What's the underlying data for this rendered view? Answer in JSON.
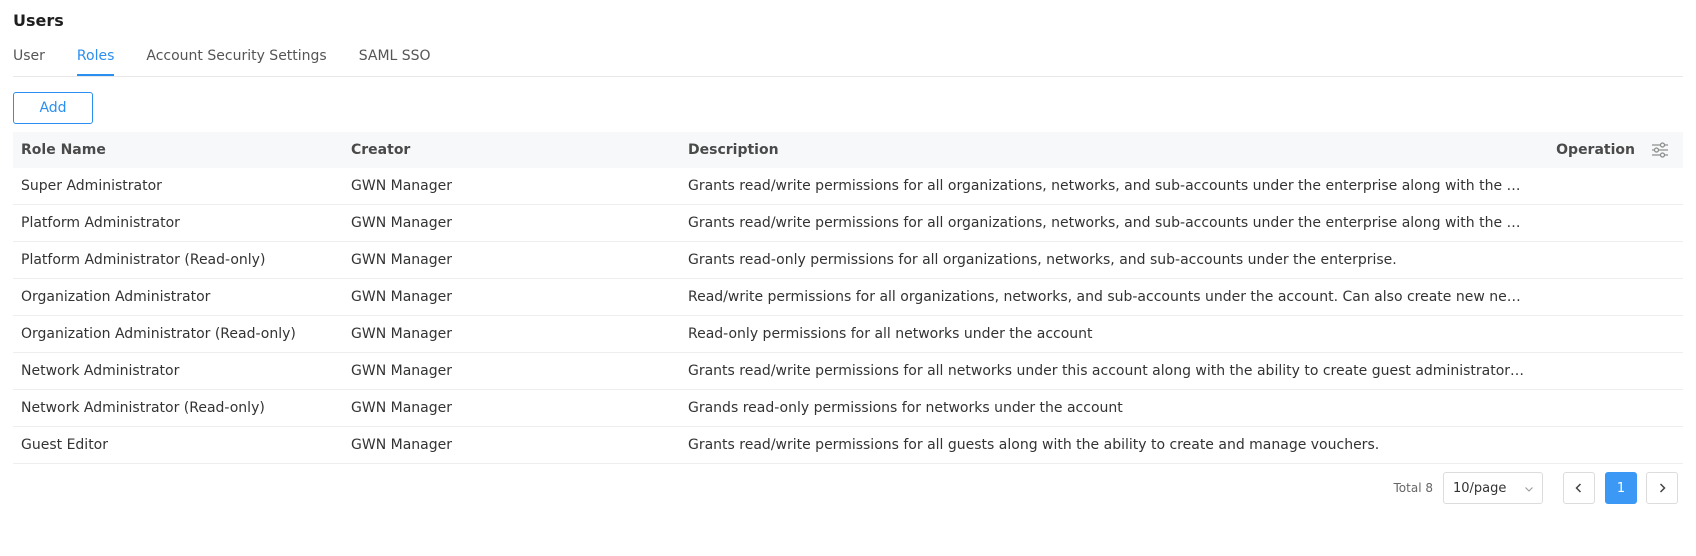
{
  "page": {
    "title": "Users"
  },
  "tabs": [
    {
      "label": "User",
      "active": false
    },
    {
      "label": "Roles",
      "active": true
    },
    {
      "label": "Account Security Settings",
      "active": false
    },
    {
      "label": "SAML SSO",
      "active": false
    }
  ],
  "toolbar": {
    "add_label": "Add"
  },
  "table": {
    "headers": {
      "role_name": "Role Name",
      "creator": "Creator",
      "description": "Description",
      "operation": "Operation"
    },
    "rows": [
      {
        "role_name": "Super Administrator",
        "creator": "GWN Manager",
        "description": "Grants read/write permissions for all organizations, networks, and sub-accounts under the enterprise along with the ability to cr..."
      },
      {
        "role_name": "Platform Administrator",
        "creator": "GWN Manager",
        "description": "Grants read/write permissions for all organizations, networks, and sub-accounts under the enterprise along with the ability to cr..."
      },
      {
        "role_name": "Platform Administrator (Read-only)",
        "creator": "GWN Manager",
        "description": "Grants read-only permissions for all organizations, networks, and sub-accounts under the enterprise."
      },
      {
        "role_name": "Organization Administrator",
        "creator": "GWN Manager",
        "description": "Read/write permissions for all organizations, networks, and sub-accounts under the account. Can also create new networks and ..."
      },
      {
        "role_name": "Organization Administrator (Read-only)",
        "creator": "GWN Manager",
        "description": "Read-only permissions for all networks under the account"
      },
      {
        "role_name": "Network Administrator",
        "creator": "GWN Manager",
        "description": "Grants read/write permissions for all networks under this account along with the ability to create guest administrators for their ..."
      },
      {
        "role_name": "Network Administrator (Read-only)",
        "creator": "GWN Manager",
        "description": "Grands read-only permissions for networks under the account"
      },
      {
        "role_name": "Guest Editor",
        "creator": "GWN Manager",
        "description": "Grants read/write permissions for all guests along with the ability to create and manage vouchers."
      }
    ]
  },
  "pagination": {
    "total_label": "Total 8",
    "page_size": "10/page",
    "current_page": "1"
  },
  "icons": {
    "filter": "column-settings-icon",
    "page_size": "chevron-down-icon",
    "prev": "chevron-left-icon",
    "next": "chevron-right-icon"
  },
  "colors": {
    "accent": "#2a8ff0",
    "header_bg": "#f7f8fa",
    "current_page_bg": "#3b99f5"
  }
}
